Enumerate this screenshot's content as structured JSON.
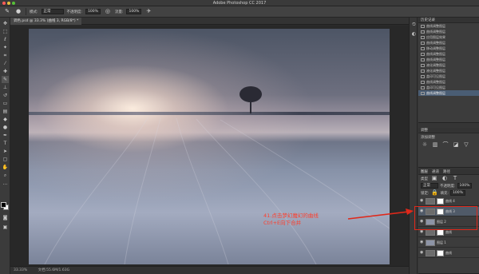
{
  "window": {
    "title": "Adobe Photoshop CC 2017",
    "traffic_colors": [
      "#fc5b57",
      "#e5bf3c",
      "#57c038"
    ]
  },
  "options_bar": {
    "mode_label": "模式:",
    "mode_value": "正常",
    "opacity_label": "不透明度:",
    "opacity_value": "100%",
    "flow_label": "流量:",
    "flow_value": "100%"
  },
  "document": {
    "tab_label": "调色.psd @ 33.3% (曲线 3, RGB/8*) *"
  },
  "status": {
    "zoom": "33.33%",
    "doc_size": "文档:55.6M/1.63G"
  },
  "history_panel": {
    "items": [
      "曲线调整图层",
      "曲线调整图层",
      "应用图层效果",
      "曲线调整图层",
      "移动调整图层",
      "曲线调整图层",
      "曲线调整图层",
      "液化调整图层",
      "液化调整图层",
      "盖印可见图层",
      "曲线调整图层",
      "盖印可见图层",
      "曲线调整图层"
    ],
    "selected_index": 12
  },
  "adjust_panel": {
    "label": "调整",
    "sub_label": "添加调整"
  },
  "layers_panel": {
    "tabs": [
      "图层",
      "通道",
      "路径"
    ],
    "filter_label": "类型",
    "blend_value": "正常",
    "opacity_label": "不透明度:",
    "opacity_value": "100%",
    "fill_label": "填充:",
    "fill_value": "100%",
    "lock_label": "锁定:",
    "rows": [
      {
        "name": "曲线 4",
        "type": "adj",
        "selected": false
      },
      {
        "name": "曲线 3",
        "type": "adj",
        "selected": true
      },
      {
        "name": "图层 2",
        "type": "pixel",
        "selected": false
      },
      {
        "name": "曲线",
        "type": "adj",
        "selected": false
      },
      {
        "name": "图层 1",
        "type": "pixel",
        "selected": false
      },
      {
        "name": "曲线",
        "type": "adj",
        "selected": false
      }
    ]
  },
  "annotation": {
    "line1": "41.点击梦幻魔幻的曲线",
    "line2": "Ctrl+E向下合并",
    "color": "#e0281a"
  }
}
